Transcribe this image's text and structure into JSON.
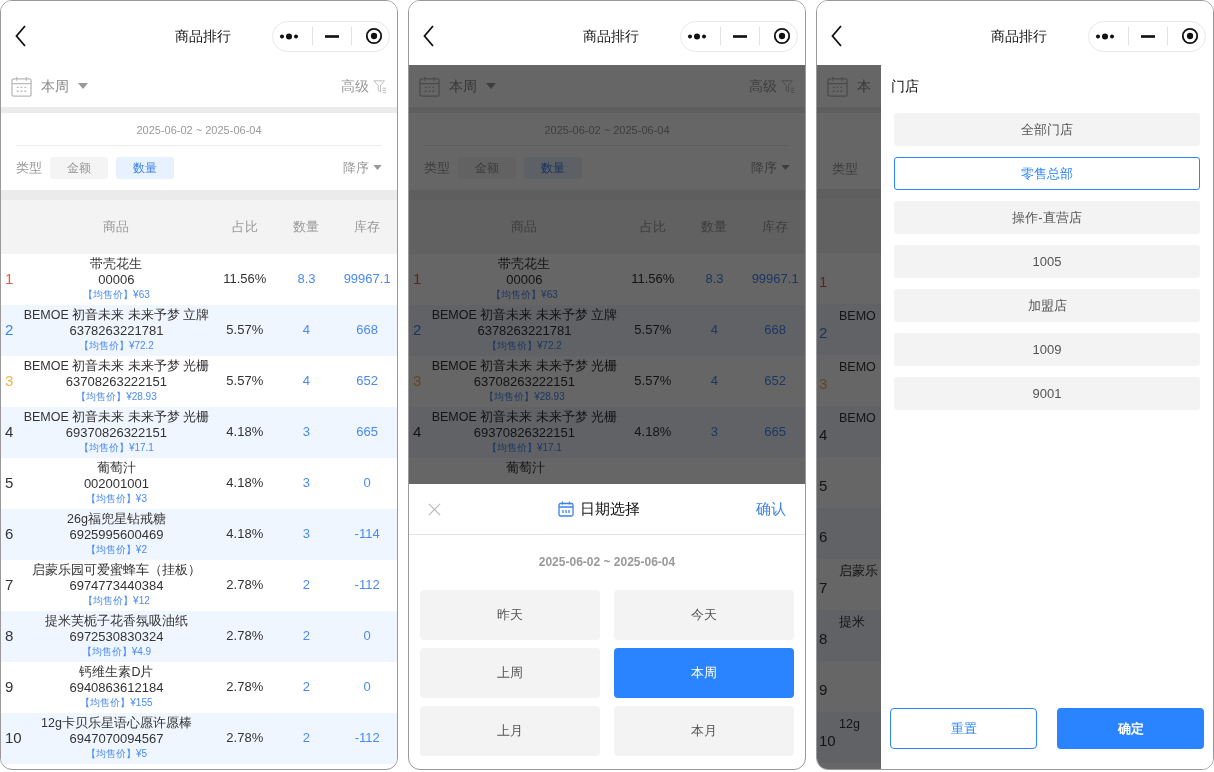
{
  "screens": [
    {
      "kind": "list",
      "title": "商品排行",
      "period": "本周",
      "advanced": "高级",
      "date_range": "2025-06-02 ~ 2025-06-04",
      "type_label": "类型",
      "type_options": [
        {
          "label": "金额",
          "selected": false
        },
        {
          "label": "数量",
          "selected": true
        }
      ],
      "sort": "降序",
      "columns": [
        "商品",
        "占比",
        "数量",
        "库存"
      ],
      "rows": [
        {
          "rank": "1",
          "color": "#e8584a",
          "name": "带壳花生",
          "code": "00006",
          "price": "【均售价】¥63",
          "share": "11.56%",
          "qty": "8.3",
          "stock": "99967.1"
        },
        {
          "rank": "2",
          "color": "#3d82e8",
          "name": "BEMOE 初音未来 未来予梦 立牌",
          "code": "6378263221781",
          "price": "【均售价】¥72.2",
          "share": "5.57%",
          "qty": "4",
          "stock": "668"
        },
        {
          "rank": "3",
          "color": "#f0b34a",
          "name": "BEMOE 初音未来 未来予梦 光栅",
          "code": "63708263222151",
          "price": "【均售价】¥28.93",
          "share": "5.57%",
          "qty": "4",
          "stock": "652"
        },
        {
          "rank": "4",
          "color": "#333333",
          "name": "BEMOE 初音未来 未来予梦 光栅",
          "code": "69370826322151",
          "price": "【均售价】¥17.1",
          "share": "4.18%",
          "qty": "3",
          "stock": "665"
        },
        {
          "rank": "5",
          "color": "#333333",
          "name": "葡萄汁",
          "code": "002001001",
          "price": "【均售价】¥3",
          "share": "4.18%",
          "qty": "3",
          "stock": "0"
        },
        {
          "rank": "6",
          "color": "#333333",
          "name": "26g福兜星钻戒糖",
          "code": "6925995600469",
          "price": "【均售价】¥2",
          "share": "4.18%",
          "qty": "3",
          "stock": "-114"
        },
        {
          "rank": "7",
          "color": "#333333",
          "name": "启蒙乐园可爱蜜蜂车（挂板）",
          "code": "6974773440384",
          "price": "【均售价】¥12",
          "share": "2.78%",
          "qty": "2",
          "stock": "-112"
        },
        {
          "rank": "8",
          "color": "#333333",
          "name": "提米芙栀子花香氛吸油纸",
          "code": "6972530830324",
          "price": "【均售价】¥4.9",
          "share": "2.78%",
          "qty": "2",
          "stock": "0"
        },
        {
          "rank": "9",
          "color": "#333333",
          "name": "钙维生素D片",
          "code": "6940863612184",
          "price": "【均售价】¥155",
          "share": "2.78%",
          "qty": "2",
          "stock": "0"
        },
        {
          "rank": "10",
          "color": "#333333",
          "name": "12g卡贝乐星语心愿许愿棒",
          "code": "6947070094567",
          "price": "【均售价】¥5",
          "share": "2.78%",
          "qty": "2",
          "stock": "-112"
        }
      ]
    },
    {
      "kind": "date_sheet",
      "title": "商品排行",
      "period": "本周",
      "advanced": "高级",
      "date_range": "2025-06-02 ~ 2025-06-04",
      "type_label": "类型",
      "type_options": [
        {
          "label": "金额",
          "selected": false
        },
        {
          "label": "数量",
          "selected": true
        }
      ],
      "sort": "降序",
      "columns": [
        "商品",
        "占比",
        "数量",
        "库存"
      ],
      "rows": [
        {
          "rank": "1",
          "color": "#5d231e",
          "name": "带壳花生",
          "code": "00006",
          "price": "【均售价】¥63",
          "share": "11.56%",
          "qty": "8.3",
          "stock": "99967.1"
        },
        {
          "rank": "2",
          "color": "#18345d",
          "name": "BEMOE 初音未来 未来予梦 立牌",
          "code": "6378263221781",
          "price": "【均售价】¥72.2",
          "share": "5.57%",
          "qty": "4",
          "stock": "668"
        },
        {
          "rank": "3",
          "color": "#60481e",
          "name": "BEMOE 初音未来 未来予梦 光栅",
          "code": "63708263222151",
          "price": "【均售价】¥28.93",
          "share": "5.57%",
          "qty": "4",
          "stock": "652"
        },
        {
          "rank": "4",
          "color": "#141414",
          "name": "BEMOE 初音未来 未来予梦 光栅",
          "code": "69370826322151",
          "price": "【均售价】¥17.1",
          "share": "4.18%",
          "qty": "3",
          "stock": "665"
        },
        {
          "name": "葡萄汁"
        }
      ],
      "sheet": {
        "title": "日期选择",
        "confirm": "确认",
        "range": "2025-06-02 ~ 2025-06-04",
        "options": [
          {
            "label": "昨天",
            "selected": false
          },
          {
            "label": "今天",
            "selected": false
          },
          {
            "label": "上周",
            "selected": false
          },
          {
            "label": "本周",
            "selected": true
          },
          {
            "label": "上月",
            "selected": false
          },
          {
            "label": "本月",
            "selected": false
          }
        ]
      }
    },
    {
      "kind": "store_drawer",
      "title": "商品排行",
      "period": "本",
      "type_label": "类型",
      "rows": [
        {
          "rank": "1",
          "color": "#5d231e"
        },
        {
          "rank": "2",
          "color": "#18345d",
          "name": "BEMO"
        },
        {
          "rank": "3",
          "color": "#60481e",
          "name": "BEMO"
        },
        {
          "rank": "4",
          "color": "#141414",
          "name": "BEMO"
        },
        {
          "rank": "5",
          "color": "#141414"
        },
        {
          "rank": "6",
          "color": "#141414"
        },
        {
          "rank": "7",
          "color": "#141414",
          "name": "启蒙乐"
        },
        {
          "rank": "8",
          "color": "#141414",
          "name": "提米"
        },
        {
          "rank": "9",
          "color": "#141414"
        },
        {
          "rank": "10",
          "color": "#141414",
          "name": "12g"
        }
      ],
      "drawer": {
        "section": "门店",
        "options": [
          {
            "label": "全部门店",
            "selected": false
          },
          {
            "label": "零售总部",
            "selected": true
          },
          {
            "label": "操作-直营店",
            "selected": false
          },
          {
            "label": "1005",
            "selected": false
          },
          {
            "label": "加盟店",
            "selected": false
          },
          {
            "label": "1009",
            "selected": false
          },
          {
            "label": "9001",
            "selected": false
          }
        ],
        "reset": "重置",
        "ok": "确定"
      }
    }
  ]
}
